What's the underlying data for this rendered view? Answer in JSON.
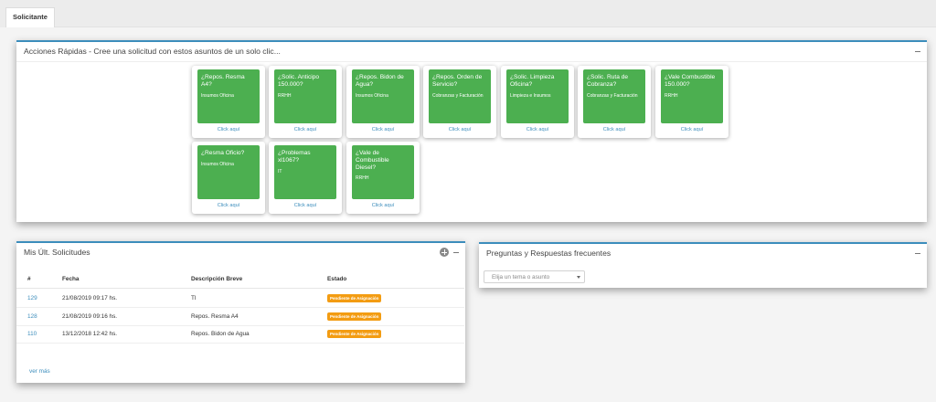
{
  "tabs": [
    {
      "label": "Solicitante"
    }
  ],
  "quick_actions": {
    "title": "Acciones Rápidas - Cree una solicitud con estos asuntos de un solo clic...",
    "cards": [
      {
        "title": "¿Repos. Resma A4?",
        "category": "Insumos Oficina",
        "link": "Click aquí"
      },
      {
        "title": "¿Solic. Anticipo 150.000?",
        "category": "RRHH",
        "link": "Click aquí"
      },
      {
        "title": "¿Repos. Bidon de Agua?",
        "category": "Insumos Oficina",
        "link": "Click aquí"
      },
      {
        "title": "¿Repos. Orden de Servicio?",
        "category": "Cobranzas y Facturación",
        "link": "Click aquí"
      },
      {
        "title": "¿Solic. Limpieza Oficina?",
        "category": "Limpieza e Insumos",
        "link": "Click aquí"
      },
      {
        "title": "¿Solic. Ruta de Cobranza?",
        "category": "Cobranzas y Facturación",
        "link": "Click aquí"
      },
      {
        "title": "¿Vale Combustible 150.000?",
        "category": "RRHH",
        "link": "Click aquí"
      },
      {
        "title": "¿Resma Oficio?",
        "category": "Insumos Oficina",
        "link": "Click aquí"
      },
      {
        "title": "¿Problemas xl1067?",
        "category": "IT",
        "link": "Click aquí"
      },
      {
        "title": "¿Vale de Combustible Diesel?",
        "category": "RRHH",
        "link": "Click aquí"
      }
    ]
  },
  "requests": {
    "title": "Mis Últ. Solicitudes",
    "columns": [
      "#",
      "Fecha",
      "Descripción Breve",
      "Estado"
    ],
    "rows": [
      {
        "id": "129",
        "date": "21/08/2019 09:17 hs.",
        "description": "TI",
        "status": "Pendiente de Asignación"
      },
      {
        "id": "128",
        "date": "21/08/2019 09:16 hs.",
        "description": "Repos. Resma A4",
        "status": "Pendiente de Asignación"
      },
      {
        "id": "110",
        "date": "13/12/2018 12:42 hs.",
        "description": "Repos. Bidon de Agua",
        "status": "Pendiente de Asignación"
      }
    ],
    "more_link": "ver más"
  },
  "faq": {
    "title": "Preguntas y Respuestas frecuentes",
    "select_placeholder": "Elija un tema o asunto"
  },
  "colors": {
    "accent": "#3c8dbc",
    "card_green": "#4caf50",
    "badge_orange": "#f39c12"
  },
  "icons": {
    "collapse": "minus-icon",
    "add": "plus-circle-icon",
    "dropdown": "caret-down-icon"
  }
}
